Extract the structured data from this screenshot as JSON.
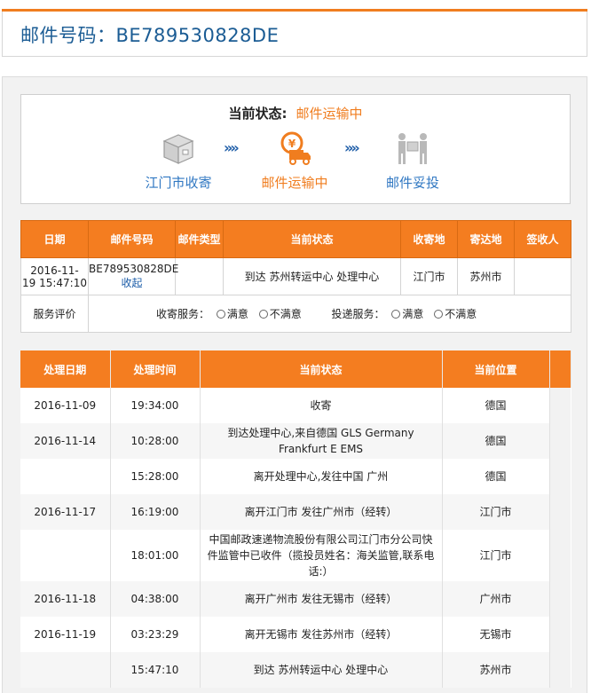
{
  "header": {
    "title": "邮件号码：BE789530828DE"
  },
  "status": {
    "label": "当前状态:",
    "value": "邮件运输中",
    "steps": [
      {
        "label": "江门市收寄",
        "icon": "package-box-icon",
        "state": "done"
      },
      {
        "label": "邮件运输中",
        "icon": "delivery-truck-icon",
        "state": "current"
      },
      {
        "label": "邮件妥投",
        "icon": "handover-icon",
        "state": "pending"
      }
    ],
    "arrow": "»»"
  },
  "summary": {
    "headers": [
      "日期",
      "邮件号码",
      "邮件类型",
      "当前状态",
      "收寄地",
      "寄达地",
      "签收人"
    ],
    "row": {
      "date": "2016-11-19 15:47:10",
      "date_line1": "2016-11-",
      "date_line2": "19 15:47:10",
      "number": "BE789530828DE",
      "collapse": "收起",
      "type": "",
      "status": "到达  苏州转运中心  处理中心",
      "origin": "江门市",
      "dest": "苏州市",
      "signer": ""
    },
    "evaluation": {
      "label": "服务评价",
      "collect_label": "收寄服务：",
      "deliver_label": "投递服务：",
      "satisfied": "满意",
      "unsatisfied": "不满意"
    }
  },
  "tracking": {
    "headers": [
      "处理日期",
      "处理时间",
      "当前状态",
      "当前位置"
    ],
    "rows": [
      {
        "date": "2016-11-09",
        "time": "19:34:00",
        "status": "收寄",
        "location": "德国"
      },
      {
        "date": "2016-11-14",
        "time": "10:28:00",
        "status": "到达处理中心,来自德国  GLS Germany Frankfurt E EMS",
        "location": "德国"
      },
      {
        "date": "",
        "time": "15:28:00",
        "status": "离开处理中心,发往中国  广州",
        "location": "德国"
      },
      {
        "date": "2016-11-17",
        "time": "16:19:00",
        "status": "离开江门市  发往广州市（经转）",
        "location": "江门市"
      },
      {
        "date": "",
        "time": "18:01:00",
        "status": "中国邮政速递物流股份有限公司江门市分公司快件监管中已收件（揽投员姓名：海关监管,联系电话:）",
        "location": "江门市"
      },
      {
        "date": "2016-11-18",
        "time": "04:38:00",
        "status": "离开广州市  发往无锡市（经转）",
        "location": "广州市"
      },
      {
        "date": "2016-11-19",
        "time": "03:23:29",
        "status": "离开无锡市  发往苏州市（经转）",
        "location": "无锡市"
      },
      {
        "date": "",
        "time": "15:47:10",
        "status": "到达  苏州转运中心  处理中心",
        "location": "苏州市"
      }
    ]
  },
  "colors": {
    "accent": "#f47d20",
    "link": "#1b5ca8",
    "title": "#1b5c94"
  }
}
